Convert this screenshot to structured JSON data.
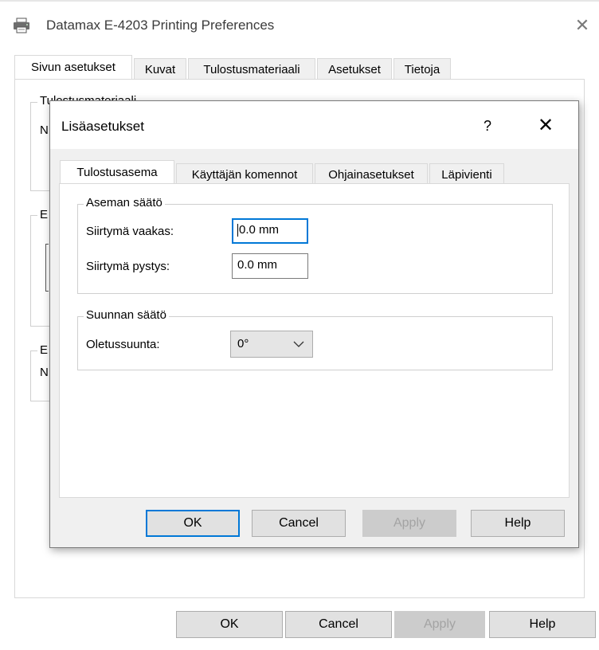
{
  "window": {
    "title": "Datamax E-4203 Printing Preferences",
    "close_glyph": "✕",
    "tabs": [
      "Sivun asetukset",
      "Kuvat",
      "Tulostusmateriaali",
      "Asetukset",
      "Tietoja"
    ],
    "active_tab": "Sivun asetukset",
    "background_group_titles": [
      "Tulostusmateriaali",
      "E",
      "E"
    ],
    "background_fragments": [
      "N",
      "N"
    ],
    "buttons": {
      "ok": "OK",
      "cancel": "Cancel",
      "apply": "Apply",
      "help": "Help"
    }
  },
  "dialog": {
    "title": "Lisäasetukset",
    "help_glyph": "?",
    "close_glyph": "✕",
    "tabs": [
      "Tulostusasema",
      "Käyttäjän komennot",
      "Ohjainasetukset",
      "Läpivienti"
    ],
    "active_tab": "Tulostusasema",
    "position_group": {
      "title": "Aseman säätö",
      "horizontal_label": "Siirtymä vaakas:",
      "horizontal_value": "0.0 mm",
      "vertical_label": "Siirtymä pystys:",
      "vertical_value": "0.0 mm"
    },
    "orientation_group": {
      "title": "Suunnan säätö",
      "default_label": "Oletussuunta:",
      "default_value": "0°"
    },
    "buttons": {
      "ok": "OK",
      "cancel": "Cancel",
      "apply": "Apply",
      "help": "Help"
    }
  },
  "icons": {
    "printer": "printer-icon",
    "chevron": "chevron-down-icon"
  },
  "colors": {
    "accent": "#0078d7",
    "disabled_text": "#a3a3a3",
    "dialog_bg": "#f0f0f0"
  }
}
